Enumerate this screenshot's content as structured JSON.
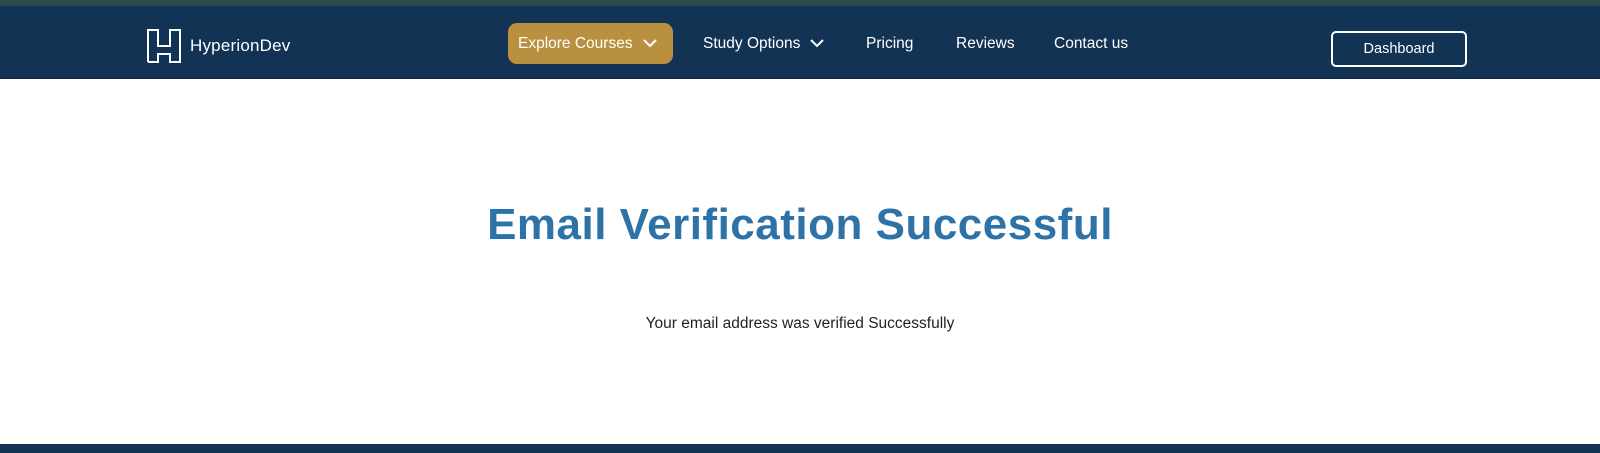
{
  "header": {
    "brand_name": "HyperionDev",
    "nav": {
      "explore_courses": "Explore Courses",
      "study_options": "Study Options",
      "pricing": "Pricing",
      "reviews": "Reviews",
      "contact_us": "Contact us"
    },
    "dashboard_label": "Dashboard"
  },
  "main": {
    "title": "Email Verification Successful",
    "message": "Your email address was verified Successfully"
  },
  "colors": {
    "navbar_bg": "#123354",
    "accent_gold": "#b89040",
    "title_blue": "#2e73a8"
  },
  "icons": {
    "logo": "hyperiondev-logo-icon",
    "dropdown": "chevron-down-icon"
  }
}
